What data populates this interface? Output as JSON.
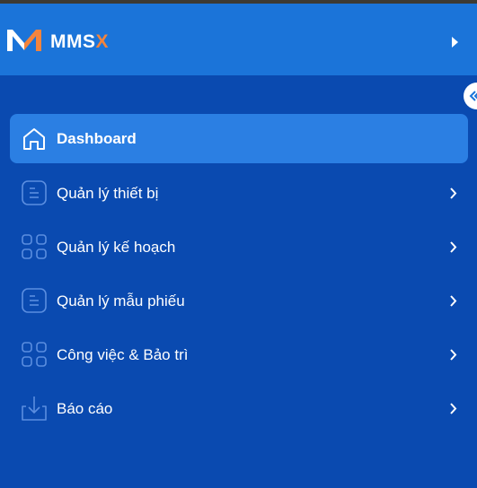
{
  "app": {
    "brand_main": "MMS",
    "brand_accent": "X",
    "accent_color": "#f4843c",
    "header_color": "#1b74d9",
    "sidebar_color": "#0a4ab0",
    "active_color": "#2b7fe3"
  },
  "nav": {
    "items": [
      {
        "label": "Dashboard",
        "icon": "home-icon",
        "active": true
      },
      {
        "label": "Quản lý thiết bị",
        "icon": "document-icon"
      },
      {
        "label": "Quản lý kế hoạch",
        "icon": "grid-icon"
      },
      {
        "label": "Quản lý mẫu phiếu",
        "icon": "document-icon"
      },
      {
        "label": "Công việc & Bảo trì",
        "icon": "grid-icon"
      },
      {
        "label": "Báo cáo",
        "icon": "download-icon"
      }
    ]
  }
}
